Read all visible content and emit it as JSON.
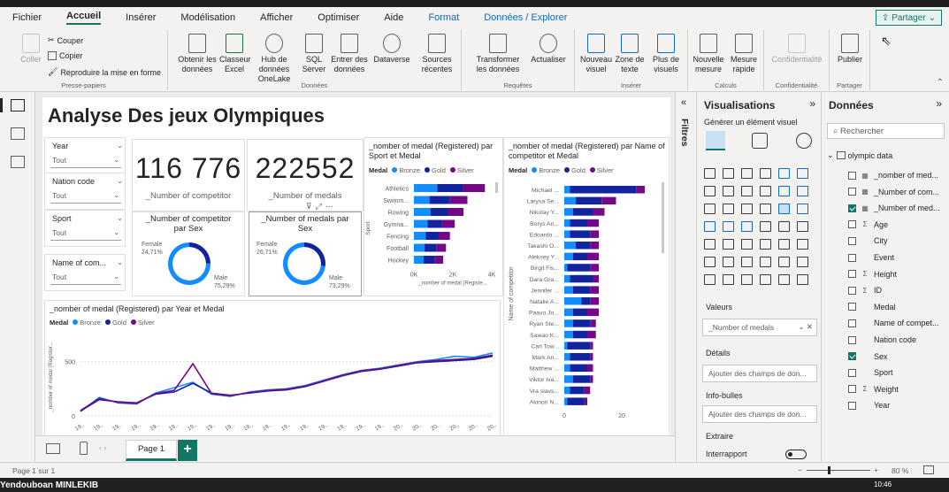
{
  "menu": {
    "items": [
      "Fichier",
      "Accueil",
      "Insérer",
      "Modélisation",
      "Afficher",
      "Optimiser",
      "Aide",
      "Format",
      "Données / Explorer"
    ],
    "share": "Partager"
  },
  "ribbon": {
    "presse": {
      "paste": "Coller",
      "cut": "Couper",
      "copy": "Copier",
      "format": "Reproduire la mise en forme",
      "group": "Presse-papiers"
    },
    "donnees": {
      "buttons": [
        "Obtenir les données",
        "Classeur Excel",
        "Hub de données OneLake",
        "SQL Server",
        "Entrer des données",
        "Dataverse",
        "Sources récentes"
      ],
      "group": "Données"
    },
    "requetes": {
      "buttons": [
        "Transformer les données",
        "Actualiser"
      ],
      "group": "Requêtes"
    },
    "inserer": {
      "buttons": [
        "Nouveau visuel",
        "Zone de texte",
        "Plus de visuels"
      ],
      "group": "Insérer"
    },
    "calculs": {
      "buttons": [
        "Nouvelle mesure",
        "Mesure rapide"
      ],
      "group": "Calculs"
    },
    "conf": {
      "buttons": [
        "Confidentialité"
      ],
      "group": "Confidentialité"
    },
    "partager": {
      "buttons": [
        "Publier"
      ],
      "group": "Partager"
    }
  },
  "report": {
    "title": "Analyse Des jeux Olympiques"
  },
  "slicers": [
    {
      "title": "Year",
      "value": "Tout"
    },
    {
      "title": "Nation code",
      "value": "Tout"
    },
    {
      "title": "Sport",
      "value": "Tout"
    },
    {
      "title": "Name of com...",
      "value": "Tout"
    }
  ],
  "cards": [
    {
      "value": "116 776",
      "label": "_Number of competitor"
    },
    {
      "value": "222552",
      "label": "_Number of medals"
    }
  ],
  "donuts": [
    {
      "title": "_Number of competitor par Sex",
      "female_label": "Female",
      "female_pct": "24,71%",
      "male_label": "Male",
      "male_pct": "75,29%",
      "female_frac": 0.2471
    },
    {
      "title": "_Number of medals par Sex",
      "female_label": "Female",
      "female_pct": "26,71%",
      "male_label": "Male",
      "male_pct": "73,29%",
      "female_frac": 0.2671
    }
  ],
  "legend": {
    "label": "Medal",
    "items": [
      "Bronze",
      "Gold",
      "Silver"
    ]
  },
  "colors": {
    "bronze": "#118dff",
    "gold": "#12239e",
    "silver": "#750985",
    "accent": "#117865"
  },
  "chart_data": [
    {
      "type": "bar",
      "title": "_nomber of medal (Registered) par Sport et Medal",
      "ylabel": "Sport",
      "xlabel": "_nomber of medal (Registe...",
      "xticks": [
        "0K",
        "2K",
        "4K"
      ],
      "xlim": [
        0,
        4000
      ],
      "categories": [
        "Athletics",
        "Swimm...",
        "Rowing",
        "Gymna...",
        "Fencing",
        "Football",
        "Hockey"
      ],
      "series": [
        {
          "name": "Bronze",
          "values": [
            1200,
            800,
            850,
            700,
            600,
            550,
            500
          ]
        },
        {
          "name": "Gold",
          "values": [
            1300,
            1050,
            900,
            750,
            650,
            600,
            550
          ]
        },
        {
          "name": "Silver",
          "values": [
            1150,
            900,
            800,
            650,
            600,
            500,
            450
          ]
        }
      ]
    },
    {
      "type": "bar",
      "title": "_nomber of medal (Registered) par Name of competitor et Medal",
      "ylabel": "Name of competitor",
      "xticks": [
        "0",
        "20"
      ],
      "xlim": [
        0,
        32
      ],
      "categories": [
        "Michael ...",
        "Larysa Se...",
        "Nikolay Y...",
        "Borys An...",
        "Edoardo ...",
        "Takashi O...",
        "Aleksey Y...",
        "Birgit Fis...",
        "Dara Gra...",
        "Jennifer ...",
        "Natalie A...",
        "Paavo Jo...",
        "Ryan Ste...",
        "Sawao K...",
        "Carl Tow...",
        "Mark An...",
        "Matthew ...",
        "Viktor Iva...",
        "Vra slavs...",
        "Akinori N..."
      ],
      "series": [
        {
          "name": "Bronze",
          "values": [
            2,
            4,
            3,
            2,
            2,
            4,
            3,
            1,
            2,
            3,
            6,
            3,
            3,
            3,
            1,
            2,
            2,
            3,
            2,
            1
          ]
        },
        {
          "name": "Gold",
          "values": [
            23,
            9,
            7,
            6,
            7,
            5,
            5,
            8,
            8,
            6,
            3,
            5,
            6,
            5,
            8,
            7,
            6,
            6,
            5,
            6
          ]
        },
        {
          "name": "Silver",
          "values": [
            3,
            5,
            4,
            4,
            3,
            3,
            4,
            3,
            2,
            3,
            3,
            4,
            2,
            3,
            1,
            1,
            2,
            1,
            2,
            1
          ]
        }
      ]
    },
    {
      "type": "line",
      "title": "_nomber of medal (Registered) par Year et Medal",
      "ylabel": "_nomber of medal (Register...",
      "yticks": [
        "0",
        "500"
      ],
      "ylim": [
        0,
        750
      ],
      "x": [
        "18..",
        "19..",
        "19..",
        "19..",
        "19..",
        "19..",
        "19..",
        "19..",
        "19..",
        "19..",
        "19..",
        "19..",
        "19..",
        "19..",
        "19..",
        "19..",
        "19..",
        "20..",
        "20..",
        "20..",
        "20..",
        "20..",
        "20.."
      ],
      "series": [
        {
          "name": "Bronze",
          "values": [
            40,
            170,
            120,
            110,
            210,
            260,
            310,
            200,
            180,
            220,
            240,
            250,
            280,
            330,
            380,
            420,
            440,
            470,
            500,
            520,
            550,
            540,
            580
          ]
        },
        {
          "name": "Gold",
          "values": [
            45,
            150,
            130,
            120,
            200,
            220,
            300,
            210,
            190,
            210,
            230,
            240,
            270,
            320,
            370,
            410,
            430,
            460,
            490,
            500,
            510,
            520,
            550
          ]
        },
        {
          "name": "Silver",
          "values": [
            50,
            160,
            125,
            115,
            205,
            235,
            480,
            205,
            185,
            215,
            235,
            245,
            275,
            325,
            375,
            415,
            435,
            465,
            495,
            510,
            520,
            530,
            560
          ]
        }
      ]
    }
  ],
  "pages": {
    "tab": "Page 1",
    "add": "+"
  },
  "status": {
    "page": "Page 1 sur 1",
    "zoom": "80 %"
  },
  "panes": {
    "filters": "Filtres",
    "viz": {
      "title": "Visualisations",
      "generate": "Générer un élément visuel",
      "values_label": "Valeurs",
      "values_field": "_Number of medals",
      "details": "Détails",
      "details_ph": "Ajouter des champs de don...",
      "tooltips": "Info-bulles",
      "tooltips_ph": "Ajouter des champs de don...",
      "extract": "Extraire",
      "crossreport": "Interrapport"
    },
    "data": {
      "title": "Données",
      "search": "Rechercher",
      "table": "olympic data",
      "fields": [
        {
          "name": "_nomber of med...",
          "checked": false,
          "icon": "calc"
        },
        {
          "name": "_Number of com...",
          "checked": false,
          "icon": "calc"
        },
        {
          "name": "_Number of med...",
          "checked": true,
          "icon": "calc"
        },
        {
          "name": "Age",
          "checked": false,
          "icon": "sigma"
        },
        {
          "name": "City",
          "checked": false,
          "icon": ""
        },
        {
          "name": "Event",
          "checked": false,
          "icon": ""
        },
        {
          "name": "Height",
          "checked": false,
          "icon": "sigma"
        },
        {
          "name": "ID",
          "checked": false,
          "icon": "sigma"
        },
        {
          "name": "Medal",
          "checked": false,
          "icon": ""
        },
        {
          "name": "Name of compet...",
          "checked": false,
          "icon": ""
        },
        {
          "name": "Nation code",
          "checked": false,
          "icon": ""
        },
        {
          "name": "Sex",
          "checked": true,
          "icon": ""
        },
        {
          "name": "Sport",
          "checked": false,
          "icon": ""
        },
        {
          "name": "Weight",
          "checked": false,
          "icon": "sigma"
        },
        {
          "name": "Year",
          "checked": false,
          "icon": ""
        }
      ]
    }
  },
  "taskbar": {
    "user": "Yendouboan MINLEKIB",
    "time": "10:46"
  }
}
